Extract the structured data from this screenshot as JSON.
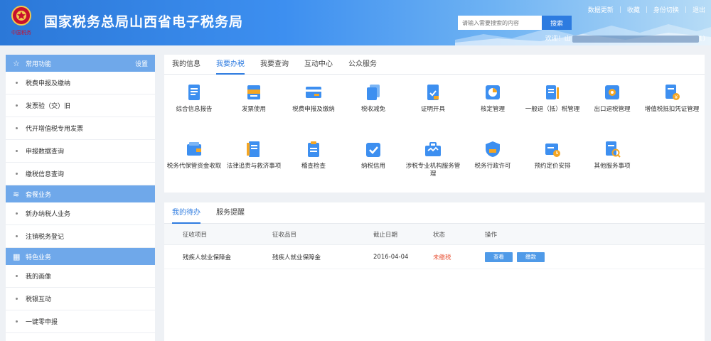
{
  "header": {
    "title": "国家税务总局山西省电子税务局",
    "top_links": [
      "数据更新",
      "收藏",
      "身份切换",
      "退出"
    ],
    "search_placeholder": "请输入需要搜索的内容",
    "search_button": "搜索",
    "welcome": "欢迎！山",
    "welcome_tail": "1)"
  },
  "sidebar": {
    "sections": [
      {
        "title": "常用功能",
        "action": "设置",
        "icon": "star-icon",
        "items": [
          "税费申报及缴纳",
          "发票验（交）旧",
          "代开增值税专用发票",
          "申报数据查询",
          "缴税信息查询"
        ]
      },
      {
        "title": "套餐业务",
        "icon": "layers-icon",
        "items": [
          "新办纳税人业务",
          "注销税务登记"
        ]
      },
      {
        "title": "特色业务",
        "icon": "grid-icon",
        "items": [
          "我的画像",
          "税银互动",
          "一键零申报"
        ]
      }
    ]
  },
  "services": {
    "tabs": [
      "我的信息",
      "我要办税",
      "我要查询",
      "互动中心",
      "公众服务"
    ],
    "active_tab": 1,
    "items": [
      {
        "label": "综合信息报告",
        "icon": "report-icon"
      },
      {
        "label": "发票使用",
        "icon": "invoice-icon"
      },
      {
        "label": "税费申报及缴纳",
        "icon": "card-icon"
      },
      {
        "label": "税收减免",
        "icon": "copy-docs-icon"
      },
      {
        "label": "证明开具",
        "icon": "certificate-icon"
      },
      {
        "label": "核定管理",
        "icon": "pie-chart-icon"
      },
      {
        "label": "一般退（抵）税管理",
        "icon": "refund-icon"
      },
      {
        "label": "出口退税管理",
        "icon": "gear-doc-icon"
      },
      {
        "label": "增值税抵扣凭证管理",
        "icon": "yen-doc-icon"
      },
      {
        "label": "税务代保管资金收取",
        "icon": "wallet-icon"
      },
      {
        "label": "法律追责与救济事项",
        "icon": "law-book-icon"
      },
      {
        "label": "稽查检查",
        "icon": "clipboard-icon"
      },
      {
        "label": "纳税信用",
        "icon": "check-shield-icon"
      },
      {
        "label": "涉税专业机构服务管理",
        "icon": "briefcase-icon"
      },
      {
        "label": "税务行政许可",
        "icon": "badge-shield-icon"
      },
      {
        "label": "预约定价安排",
        "icon": "calendar-clock-icon"
      },
      {
        "label": "其他服务事项",
        "icon": "search-doc-icon"
      }
    ]
  },
  "todo": {
    "tabs": [
      "我的待办",
      "服务提醒"
    ],
    "active_tab": 0,
    "columns": [
      "征收项目",
      "征收品目",
      "截止日期",
      "状态",
      "操作"
    ],
    "rows": [
      {
        "item": "残疾人就业保障金",
        "subitem": "残疾人就业保障金",
        "deadline": "2016-04-04",
        "status": "未缴税",
        "actions": [
          "查看",
          "缴款"
        ]
      }
    ]
  },
  "colors": {
    "primary": "#2d7be0",
    "sidebar_head": "#6fa8ea",
    "status_unpaid": "#e8563a",
    "icon_blue": "#3d8ff0",
    "icon_orange": "#f5a623"
  }
}
